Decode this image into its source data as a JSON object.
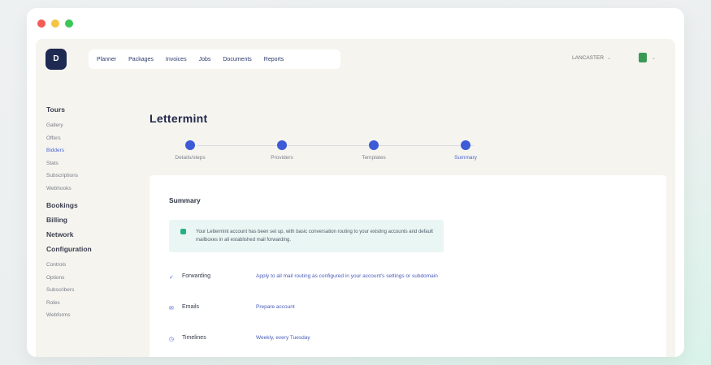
{
  "window": {
    "controls": {
      "close": "#f45b55",
      "minimize": "#f6c445",
      "maximize": "#3cc655"
    }
  },
  "app": {
    "logo": {
      "text": "D"
    },
    "topnav": [
      "Planner",
      "Packages",
      "Invoices",
      "Jobs",
      "Documents",
      "Reports"
    ],
    "account": {
      "label": "LANCASTER",
      "chevron": "⌄"
    },
    "user": {
      "icon": "user-icon",
      "chevron": "⌄"
    }
  },
  "sidebar": {
    "groups": [
      {
        "title": "Tours",
        "items": [
          "Gallery",
          "Offers",
          "Bidders",
          "Stats",
          "Subscriptions",
          "Webhooks"
        ],
        "active": "Bidders"
      },
      {
        "title": "Bookings",
        "items": []
      },
      {
        "title": "Billing",
        "items": []
      },
      {
        "title": "Network",
        "items": []
      },
      {
        "title": "Configuration",
        "items": [
          "Controls",
          "Options",
          "Subscribers",
          "Roles",
          "Webforms"
        ]
      }
    ]
  },
  "main": {
    "title": "Lettermint",
    "steps": [
      {
        "label": "Details/steps"
      },
      {
        "label": "Providers"
      },
      {
        "label": "Templates"
      },
      {
        "label": "Summary",
        "current": true
      }
    ],
    "summary": {
      "title": "Summary",
      "alert": "Your Lettermint account has been set up, with basic conversation routing to your existing accounts and default mailboxes in all established mail forwarding.",
      "rows": [
        {
          "icon": "check-icon",
          "label": "Forwarding",
          "value": "Apply to all mail routing as configured in your account's settings or subdomain"
        },
        {
          "icon": "mail-icon",
          "label": "Emails",
          "value": "Prepare account"
        },
        {
          "icon": "clock-icon",
          "label": "Timelines",
          "value": "Weekly, every Tuesday"
        }
      ]
    }
  },
  "colors": {
    "accent": "#3d5bd6",
    "brand": "#1f2a52",
    "success": "#27b07f",
    "app_background": "#f5f4ef"
  }
}
